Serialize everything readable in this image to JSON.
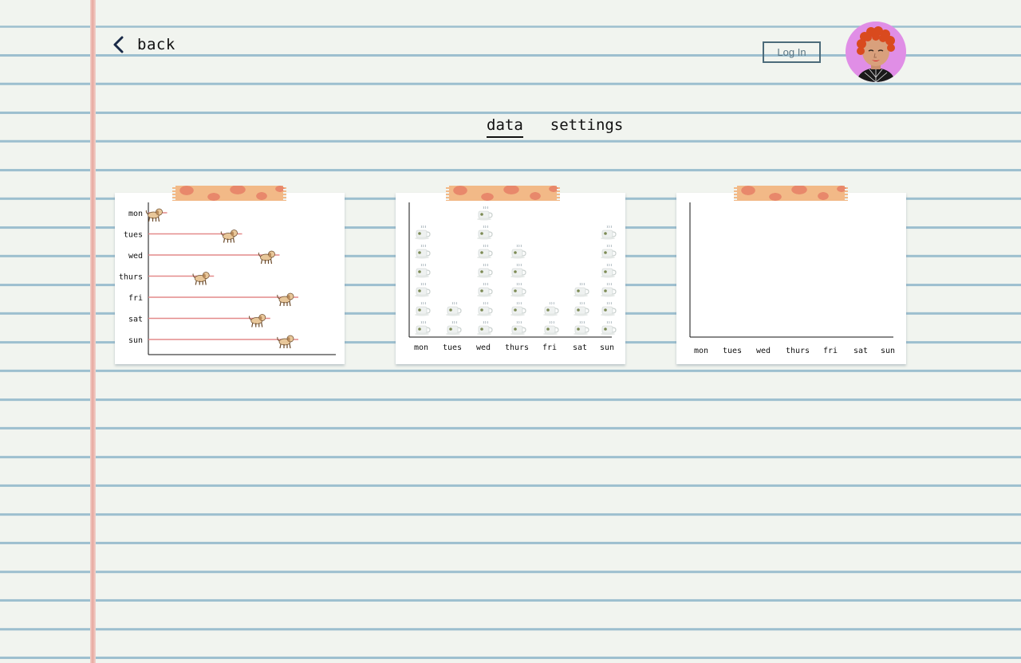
{
  "header": {
    "back_label": "back",
    "login_label": "Log In"
  },
  "tabs": [
    {
      "label": "data",
      "active": true
    },
    {
      "label": "settings",
      "active": false
    }
  ],
  "colors": {
    "walk_line": "#e48a8a",
    "avatar_bg": "#e08ee6",
    "tape": "#f2b987",
    "tape_dots": "#e8886b"
  },
  "chart_data": [
    {
      "type": "bar",
      "orientation": "horizontal",
      "icon": "dog-icon",
      "categories": [
        "mon",
        "tues",
        "wed",
        "thurs",
        "fri",
        "sat",
        "sun"
      ],
      "values": [
        1,
        5,
        7,
        3.5,
        8,
        6.5,
        8
      ],
      "xlim": [
        0,
        10
      ]
    },
    {
      "type": "bar",
      "icon": "coffee-cup-icon",
      "categories": [
        "mon",
        "tues",
        "wed",
        "thurs",
        "fri",
        "sat",
        "sun"
      ],
      "values": [
        6,
        2,
        7,
        5,
        2,
        3,
        6
      ],
      "ylim": [
        0,
        7
      ]
    },
    {
      "type": "bar",
      "categories": [
        "mon",
        "tues",
        "wed",
        "thurs",
        "fri",
        "sat",
        "sun"
      ],
      "values": []
    }
  ]
}
